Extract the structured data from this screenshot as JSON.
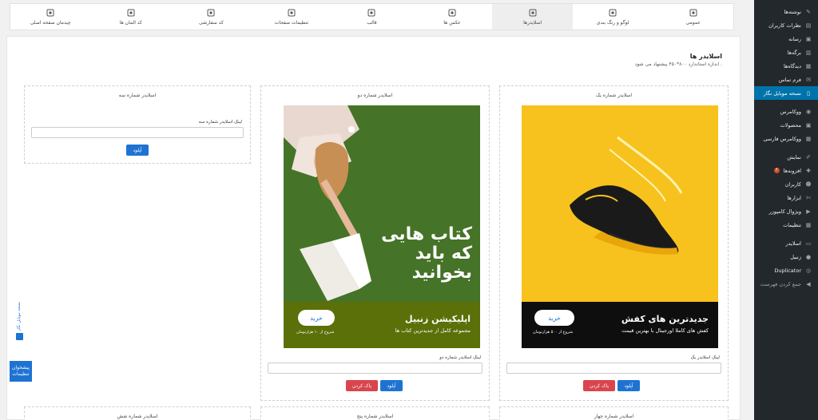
{
  "tabs": [
    {
      "label": "عمومی",
      "icon": "layers-icon",
      "active": false
    },
    {
      "label": "لوگو و رنگ بندی",
      "icon": "bucket-icon",
      "active": false
    },
    {
      "label": "اسلایدرها",
      "icon": "image-icon",
      "active": true
    },
    {
      "label": "عکس ها",
      "icon": "image-icon",
      "active": false
    },
    {
      "label": "قالب",
      "icon": "puzzle-icon",
      "active": false
    },
    {
      "label": "تنظیمات صفحات",
      "icon": "pages-icon",
      "active": false
    },
    {
      "label": "کد سفارشی",
      "icon": "gear-icon",
      "active": false
    },
    {
      "label": "کد المان ها",
      "icon": "gear-icon",
      "active": false
    },
    {
      "label": "چیدمان صفحه اصلی",
      "icon": "layout-icon",
      "active": false
    }
  ],
  "panel": {
    "title": "اسلایدر ها",
    "subtitle": "اندازه استاندارد ۸۰۰*۴۵۰ پیشنهاد می شود ."
  },
  "slots": [
    {
      "title": "اسلایدر شماره یک",
      "link_label": "لینک اسلایدر یک",
      "link_value": "",
      "upload": "آپلود",
      "clear": "پاک کردن"
    },
    {
      "title": "اسلایدر شماره دو",
      "link_label": "لینک اسلایدر شماره دو",
      "link_value": "",
      "upload": "آپلود",
      "clear": "پاک کردن"
    },
    {
      "title": "اسلایدر شماره سه",
      "link_label": "لینک اسلایدر شماره سه",
      "link_value": "",
      "upload": "آپلود"
    },
    {
      "title": "اسلایدر شماره چهار"
    },
    {
      "title": "اسلایدر شماره پنج"
    },
    {
      "title": "اسلایدر شماره شش"
    }
  ],
  "banner1": {
    "heading": "جدیدترین های کفش",
    "desc": "کفش های کاملا اورجینال با بهترین قیمت",
    "buy": "خرید",
    "price": "شروع از ۵۰۰ هزارتومان",
    "bg_color": "#f7c21d",
    "strip_color": "#0e0e0e"
  },
  "banner2": {
    "big_line1": "کتاب هایی",
    "big_line2": "که باید",
    "big_line3": "بخوانید",
    "heading": "اپلیکیشن زنبیل",
    "desc": "مجموعه کامل از جدیدترین کتاب ها",
    "buy": "خرید",
    "price": "شروع از ۱۰ هزارتومان",
    "strip_color": "#5b7008",
    "grass_color": "#4c7a2a"
  },
  "float_widget": {
    "line1": "پیشخوان",
    "line2": "تنظیمات",
    "vertical_text": "نسخه موبایل نگار"
  },
  "sidebar": [
    {
      "label": "نوشته‌ها",
      "icon": "pin-icon"
    },
    {
      "label": "نظرات کاربران",
      "icon": "comment-icon"
    },
    {
      "label": "رسانه",
      "icon": "media-icon"
    },
    {
      "label": "برگه‌ها",
      "icon": "page-icon"
    },
    {
      "label": "دیدگاه‌ها",
      "icon": "comments-icon"
    },
    {
      "label": "فرم تماس",
      "icon": "mail-icon"
    },
    {
      "label": "نسخه موبایل نگار",
      "icon": "mobile-icon",
      "active": true
    },
    {
      "sep": true
    },
    {
      "label": "ووکامرس",
      "icon": "woo-icon"
    },
    {
      "label": "محصولات",
      "icon": "box-icon"
    },
    {
      "label": "ووکامرس فارسی",
      "icon": "woo-fa-icon"
    },
    {
      "sep": true
    },
    {
      "label": "نمایش",
      "icon": "brush-icon"
    },
    {
      "label": "افزونه‌ها",
      "icon": "plugin-icon",
      "badge": "۴"
    },
    {
      "label": "کاربران",
      "icon": "user-icon"
    },
    {
      "label": "ابزارها",
      "icon": "wrench-icon"
    },
    {
      "label": "ویژوال کامپوزر",
      "icon": "vc-icon"
    },
    {
      "label": "تنظیمات",
      "icon": "settings-icon"
    },
    {
      "sep": true
    },
    {
      "label": "اسلایدر",
      "icon": "slider-icon"
    },
    {
      "label": "زنبیل",
      "icon": "coin-icon"
    },
    {
      "label": "Duplicator",
      "icon": "duplicator-icon"
    },
    {
      "label": "جمع کردن فهرست",
      "icon": "collapse-icon",
      "muted": true
    }
  ]
}
